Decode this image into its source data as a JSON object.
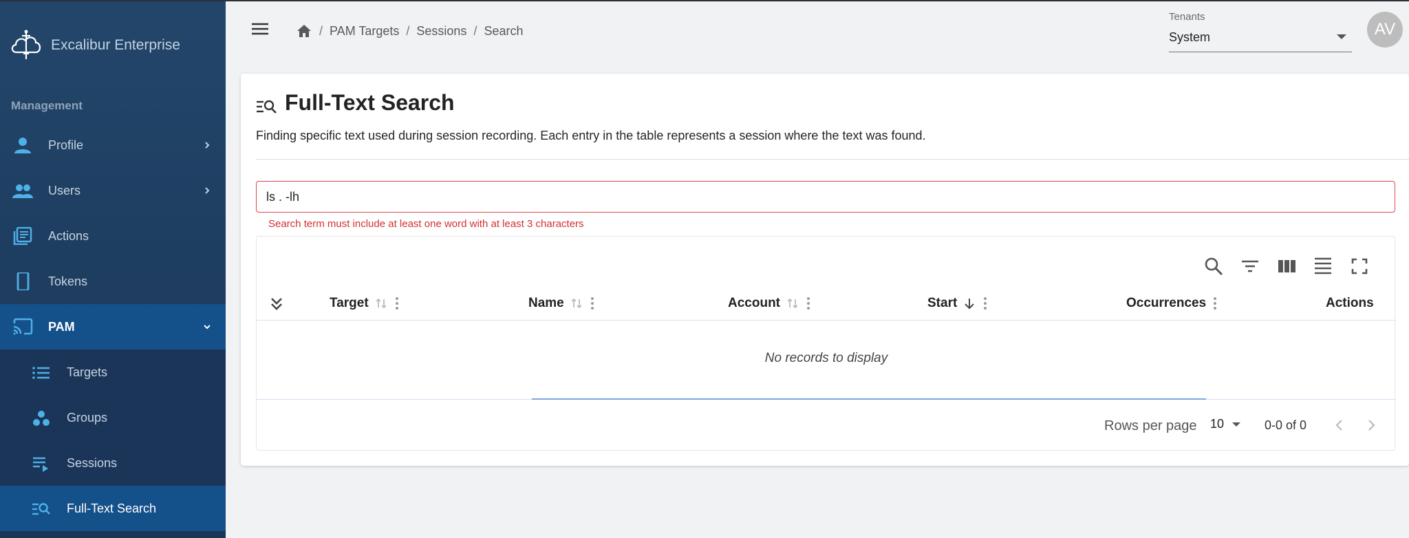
{
  "app": {
    "name": "Excalibur Enterprise"
  },
  "sidebar": {
    "section_title": "Management",
    "items": [
      {
        "label": "Profile",
        "icon": "person-icon",
        "has_chevron": true
      },
      {
        "label": "Users",
        "icon": "people-icon",
        "has_chevron": true
      },
      {
        "label": "Actions",
        "icon": "library-books-icon",
        "has_chevron": false
      },
      {
        "label": "Tokens",
        "icon": "phone-device-icon",
        "has_chevron": false
      },
      {
        "label": "PAM",
        "icon": "cast-icon",
        "has_chevron": true,
        "expanded": true
      }
    ],
    "pam_children": [
      {
        "label": "Targets",
        "icon": "list-icon"
      },
      {
        "label": "Groups",
        "icon": "groups-dots-icon"
      },
      {
        "label": "Sessions",
        "icon": "playlist-play-icon"
      },
      {
        "label": "Full-Text Search",
        "icon": "manage-search-icon",
        "active": true
      }
    ]
  },
  "header": {
    "breadcrumb": [
      "PAM Targets",
      "Sessions",
      "Search"
    ],
    "tenants": {
      "label": "Tenants",
      "value": "System"
    },
    "avatar_initials": "AV"
  },
  "page": {
    "title": "Full-Text Search",
    "description": "Finding specific text used during session recording. Each entry in the table represents a session where the text was found.",
    "search": {
      "value": "ls . -lh",
      "error": "Search term must include at least one word with at least 3 characters"
    }
  },
  "table": {
    "toolbar_icons": [
      "search-icon",
      "filter-icon",
      "columns-icon",
      "density-icon",
      "fullscreen-icon"
    ],
    "columns": [
      "Target",
      "Name",
      "Account",
      "Start",
      "Occurrences",
      "Actions"
    ],
    "empty_message": "No records to display",
    "pagination": {
      "rows_per_page_label": "Rows per page",
      "rows_per_page": "10",
      "range": "0-0 of 0"
    }
  },
  "colors": {
    "sidebar": "#1d3c5e",
    "sidebar_active": "#14508a",
    "icon_accent": "#4fb0ea",
    "error": "#d32f2f"
  }
}
